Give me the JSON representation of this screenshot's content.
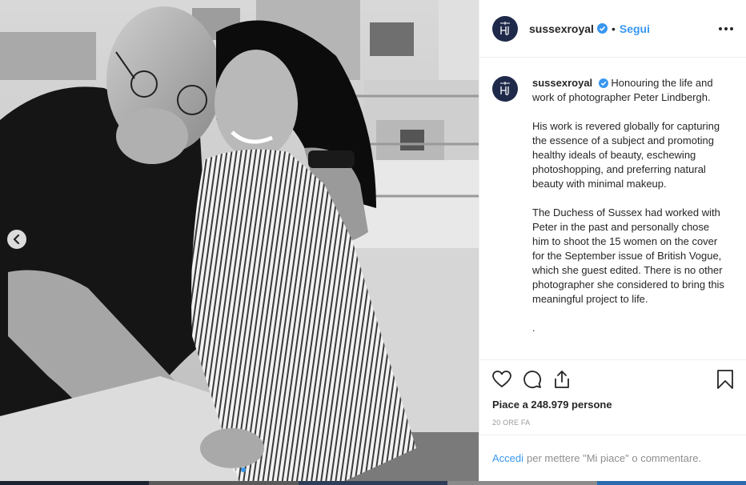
{
  "post": {
    "username": "sussexroyal",
    "separator": "•",
    "follow_label": "Segui",
    "caption_paragraphs": [
      "Honouring the life and work of photographer Peter Lindbergh.",
      "His work is revered globally for capturing the essence of a subject and promoting healthy ideals of beauty, eschewing photoshopping, and preferring natural beauty with minimal makeup.",
      "The Duchess of Sussex had worked with Peter in the past and personally chose him to shoot the 15 women on the cover for the September issue of British Vogue, which she guest edited. There is no other photographer she considered to bring this meaningful project to life.",
      "."
    ],
    "likes_text": "Piace a 248.979 persone",
    "timestamp": "20 ORE FA",
    "login_label": "Accedi",
    "login_suffix": "per mettere \"Mi piace\" o commentare.",
    "carousel": {
      "slides": 2,
      "active": 2
    }
  },
  "icons": {
    "prev": "chevron-left-icon",
    "verified": "verified-badge-icon",
    "more": "more-options-icon",
    "like": "heart-icon",
    "comment": "comment-icon",
    "share": "share-icon",
    "save": "bookmark-icon"
  },
  "colors": {
    "accent": "#3897f0",
    "text": "#262626",
    "muted": "#8e8e8e",
    "brand_avatar": "#1f2a4a"
  }
}
